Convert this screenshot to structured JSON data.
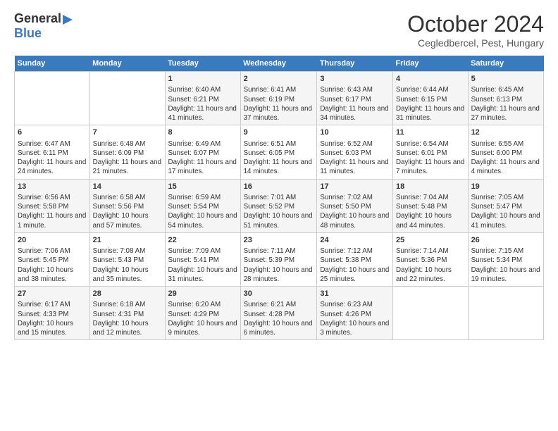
{
  "logo": {
    "general": "General",
    "blue": "Blue"
  },
  "header": {
    "month": "October 2024",
    "location": "Cegledbercel, Pest, Hungary"
  },
  "days_of_week": [
    "Sunday",
    "Monday",
    "Tuesday",
    "Wednesday",
    "Thursday",
    "Friday",
    "Saturday"
  ],
  "weeks": [
    [
      {
        "day": "",
        "content": ""
      },
      {
        "day": "",
        "content": ""
      },
      {
        "day": "1",
        "content": "Sunrise: 6:40 AM\nSunset: 6:21 PM\nDaylight: 11 hours and 41 minutes."
      },
      {
        "day": "2",
        "content": "Sunrise: 6:41 AM\nSunset: 6:19 PM\nDaylight: 11 hours and 37 minutes."
      },
      {
        "day": "3",
        "content": "Sunrise: 6:43 AM\nSunset: 6:17 PM\nDaylight: 11 hours and 34 minutes."
      },
      {
        "day": "4",
        "content": "Sunrise: 6:44 AM\nSunset: 6:15 PM\nDaylight: 11 hours and 31 minutes."
      },
      {
        "day": "5",
        "content": "Sunrise: 6:45 AM\nSunset: 6:13 PM\nDaylight: 11 hours and 27 minutes."
      }
    ],
    [
      {
        "day": "6",
        "content": "Sunrise: 6:47 AM\nSunset: 6:11 PM\nDaylight: 11 hours and 24 minutes."
      },
      {
        "day": "7",
        "content": "Sunrise: 6:48 AM\nSunset: 6:09 PM\nDaylight: 11 hours and 21 minutes."
      },
      {
        "day": "8",
        "content": "Sunrise: 6:49 AM\nSunset: 6:07 PM\nDaylight: 11 hours and 17 minutes."
      },
      {
        "day": "9",
        "content": "Sunrise: 6:51 AM\nSunset: 6:05 PM\nDaylight: 11 hours and 14 minutes."
      },
      {
        "day": "10",
        "content": "Sunrise: 6:52 AM\nSunset: 6:03 PM\nDaylight: 11 hours and 11 minutes."
      },
      {
        "day": "11",
        "content": "Sunrise: 6:54 AM\nSunset: 6:01 PM\nDaylight: 11 hours and 7 minutes."
      },
      {
        "day": "12",
        "content": "Sunrise: 6:55 AM\nSunset: 6:00 PM\nDaylight: 11 hours and 4 minutes."
      }
    ],
    [
      {
        "day": "13",
        "content": "Sunrise: 6:56 AM\nSunset: 5:58 PM\nDaylight: 11 hours and 1 minute."
      },
      {
        "day": "14",
        "content": "Sunrise: 6:58 AM\nSunset: 5:56 PM\nDaylight: 10 hours and 57 minutes."
      },
      {
        "day": "15",
        "content": "Sunrise: 6:59 AM\nSunset: 5:54 PM\nDaylight: 10 hours and 54 minutes."
      },
      {
        "day": "16",
        "content": "Sunrise: 7:01 AM\nSunset: 5:52 PM\nDaylight: 10 hours and 51 minutes."
      },
      {
        "day": "17",
        "content": "Sunrise: 7:02 AM\nSunset: 5:50 PM\nDaylight: 10 hours and 48 minutes."
      },
      {
        "day": "18",
        "content": "Sunrise: 7:04 AM\nSunset: 5:48 PM\nDaylight: 10 hours and 44 minutes."
      },
      {
        "day": "19",
        "content": "Sunrise: 7:05 AM\nSunset: 5:47 PM\nDaylight: 10 hours and 41 minutes."
      }
    ],
    [
      {
        "day": "20",
        "content": "Sunrise: 7:06 AM\nSunset: 5:45 PM\nDaylight: 10 hours and 38 minutes."
      },
      {
        "day": "21",
        "content": "Sunrise: 7:08 AM\nSunset: 5:43 PM\nDaylight: 10 hours and 35 minutes."
      },
      {
        "day": "22",
        "content": "Sunrise: 7:09 AM\nSunset: 5:41 PM\nDaylight: 10 hours and 31 minutes."
      },
      {
        "day": "23",
        "content": "Sunrise: 7:11 AM\nSunset: 5:39 PM\nDaylight: 10 hours and 28 minutes."
      },
      {
        "day": "24",
        "content": "Sunrise: 7:12 AM\nSunset: 5:38 PM\nDaylight: 10 hours and 25 minutes."
      },
      {
        "day": "25",
        "content": "Sunrise: 7:14 AM\nSunset: 5:36 PM\nDaylight: 10 hours and 22 minutes."
      },
      {
        "day": "26",
        "content": "Sunrise: 7:15 AM\nSunset: 5:34 PM\nDaylight: 10 hours and 19 minutes."
      }
    ],
    [
      {
        "day": "27",
        "content": "Sunrise: 6:17 AM\nSunset: 4:33 PM\nDaylight: 10 hours and 15 minutes."
      },
      {
        "day": "28",
        "content": "Sunrise: 6:18 AM\nSunset: 4:31 PM\nDaylight: 10 hours and 12 minutes."
      },
      {
        "day": "29",
        "content": "Sunrise: 6:20 AM\nSunset: 4:29 PM\nDaylight: 10 hours and 9 minutes."
      },
      {
        "day": "30",
        "content": "Sunrise: 6:21 AM\nSunset: 4:28 PM\nDaylight: 10 hours and 6 minutes."
      },
      {
        "day": "31",
        "content": "Sunrise: 6:23 AM\nSunset: 4:26 PM\nDaylight: 10 hours and 3 minutes."
      },
      {
        "day": "",
        "content": ""
      },
      {
        "day": "",
        "content": ""
      }
    ]
  ]
}
